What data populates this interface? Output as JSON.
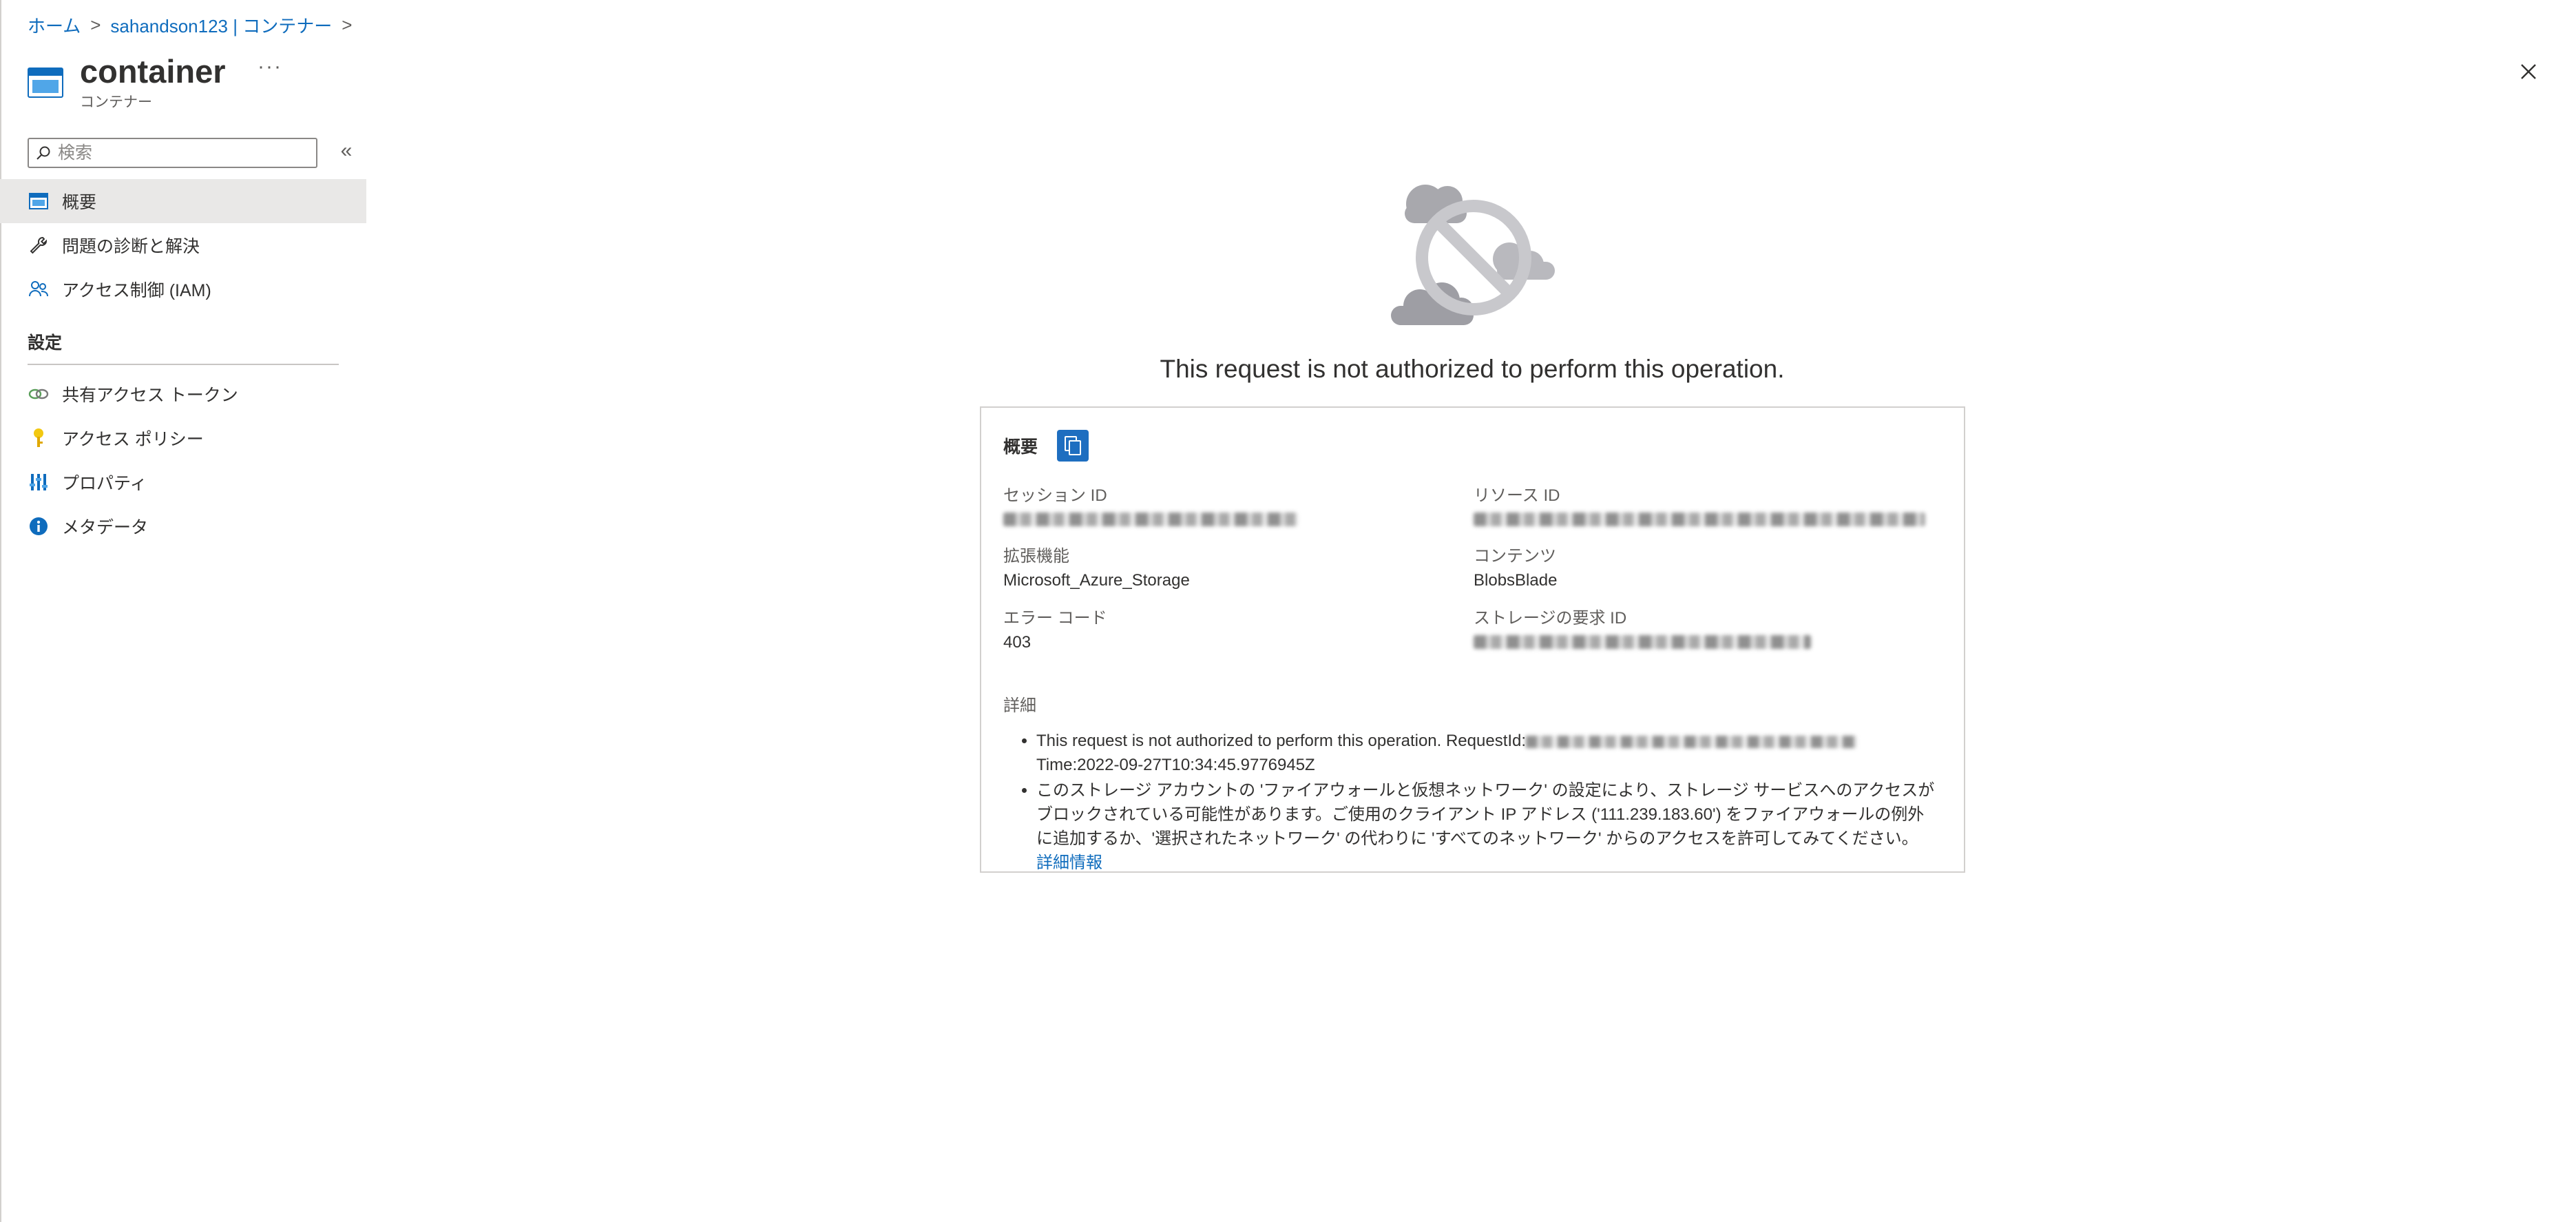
{
  "breadcrumb": {
    "home": "ホーム",
    "parent": "sahandson123 | コンテナー"
  },
  "header": {
    "title": "container",
    "subtitle": "コンテナー",
    "more": "···"
  },
  "sidebar": {
    "search_placeholder": "検索",
    "items": [
      {
        "label": "概要",
        "icon": "overview-icon",
        "active": true
      },
      {
        "label": "問題の診断と解決",
        "icon": "wrench-icon"
      },
      {
        "label": "アクセス制御 (IAM)",
        "icon": "people-icon"
      }
    ],
    "settings_heading": "設定",
    "settings_items": [
      {
        "label": "共有アクセス トークン",
        "icon": "link-icon"
      },
      {
        "label": "アクセス ポリシー",
        "icon": "key-icon"
      },
      {
        "label": "プロパティ",
        "icon": "properties-icon"
      },
      {
        "label": "メタデータ",
        "icon": "info-icon"
      }
    ]
  },
  "error": {
    "message": "This request is not authorized to perform this operation.",
    "card_title": "概要",
    "fields": {
      "session_label": "セッション ID",
      "resource_label": "リソース ID",
      "extension_label": "拡張機能",
      "extension_value": "Microsoft_Azure_Storage",
      "content_label": "コンテンツ",
      "content_value": "BlobsBlade",
      "error_code_label": "エラー コード",
      "error_code_value": "403",
      "storage_request_label": "ストレージの要求 ID"
    },
    "details_label": "詳細",
    "detail_1a": "This request is not authorized to perform this operation. RequestId:",
    "detail_1b": "Time:2022-09-27T10:34:45.9776945Z",
    "detail_2": "このストレージ アカウントの 'ファイアウォールと仮想ネットワーク' の設定により、ストレージ サービスへのアクセスがブロックされている可能性があります。ご使用のクライアント IP アドレス ('111.239.183.60') をファイアウォールの例外に追加するか、'選択されたネットワーク' の代わりに 'すべてのネットワーク' からのアクセスを許可してみてください。",
    "learn_more": "詳細情報"
  },
  "colors": {
    "accent": "#0f6cbd",
    "copy_button": "#1e6ec0",
    "active_nav": "#e9e8e7"
  }
}
